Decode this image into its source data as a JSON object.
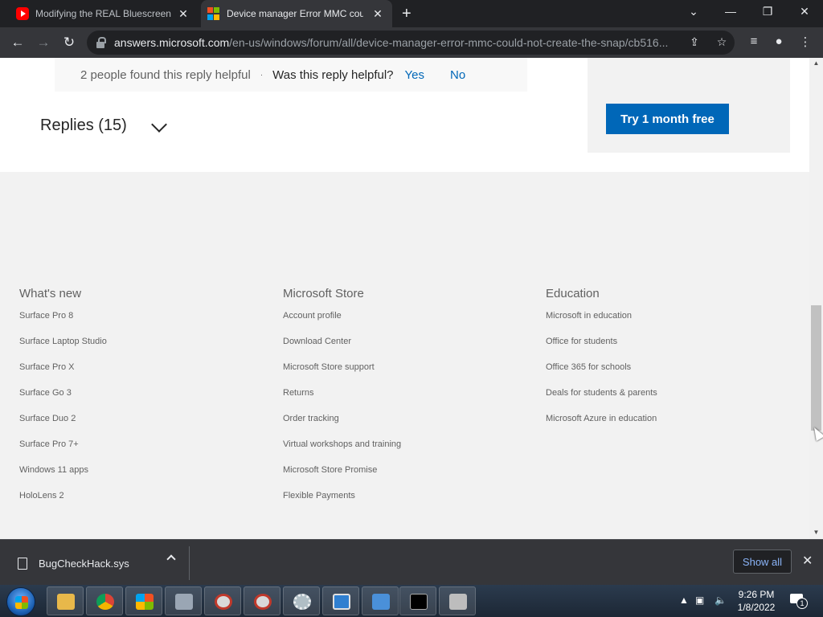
{
  "browser": {
    "tabs": [
      {
        "title": "Modifying the REAL Bluescreen in",
        "active": false,
        "icon": "youtube-icon"
      },
      {
        "title": "Device manager Error MMC could",
        "active": true,
        "icon": "microsoft-icon"
      }
    ],
    "url_host": "answers.microsoft.com",
    "url_path": "/en-us/windows/forum/all/device-manager-error-mmc-could-not-create-the-snap/cb516..."
  },
  "reply": {
    "helpful_count": "2 people found this reply helpful",
    "separator": "·",
    "question": "Was this reply helpful?",
    "yes": "Yes",
    "no": "No"
  },
  "replies": {
    "label": "Replies (15)"
  },
  "promo": {
    "button": "Try 1 month free"
  },
  "footer": {
    "columns": [
      {
        "heading": "What's new",
        "links": [
          "Surface Pro 8",
          "Surface Laptop Studio",
          "Surface Pro X",
          "Surface Go 3",
          "Surface Duo 2",
          "Surface Pro 7+",
          "Windows 11 apps",
          "HoloLens 2"
        ]
      },
      {
        "heading": "Microsoft Store",
        "links": [
          "Account profile",
          "Download Center",
          "Microsoft Store support",
          "Returns",
          "Order tracking",
          "Virtual workshops and training",
          "Microsoft Store Promise",
          "Flexible Payments"
        ]
      },
      {
        "heading": "Education",
        "links": [
          "Microsoft in education",
          "Office for students",
          "Office 365 for schools",
          "Deals for students & parents",
          "Microsoft Azure in education"
        ]
      }
    ]
  },
  "downloads": {
    "file": "BugCheckHack.sys",
    "show_all": "Show all"
  },
  "taskbar": {
    "time": "9:26 PM",
    "date": "1/8/2022",
    "notification_count": "1"
  },
  "colors": {
    "accent": "#0067b8",
    "chrome_dark": "#202124"
  }
}
